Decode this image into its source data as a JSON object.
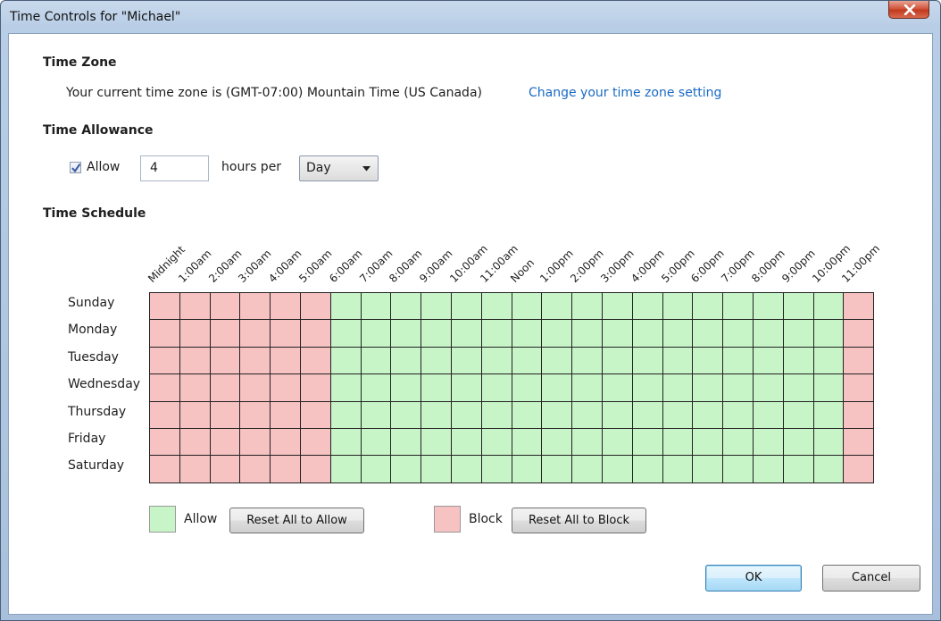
{
  "window": {
    "title": "Time Controls for \"Michael\""
  },
  "time_zone": {
    "heading": "Time Zone",
    "text": "Your current time zone is (GMT-07:00) Mountain Time (US  Canada)",
    "link": "Change your time zone setting"
  },
  "allowance": {
    "heading": "Time Allowance",
    "checkbox_label": "Allow",
    "checked": true,
    "hours_value": "4",
    "hours_label": "hours per",
    "period_value": "Day"
  },
  "schedule": {
    "heading": "Time Schedule",
    "hours": [
      "Midnight",
      "1:00am",
      "2:00am",
      "3:00am",
      "4:00am",
      "5:00am",
      "6:00am",
      "7:00am",
      "8:00am",
      "9:00am",
      "10:00am",
      "11:00am",
      "Noon",
      "1:00pm",
      "2:00pm",
      "3:00pm",
      "4:00pm",
      "5:00pm",
      "6:00pm",
      "7:00pm",
      "8:00pm",
      "9:00pm",
      "10:00pm",
      "11:00pm"
    ],
    "days": [
      "Sunday",
      "Monday",
      "Tuesday",
      "Wednesday",
      "Thursday",
      "Friday",
      "Saturday"
    ],
    "grid": [
      "BBBBBBAAAAAAAAAAAAAAAAAB",
      "BBBBBBAAAAAAAAAAAAAAAAAB",
      "BBBBBBAAAAAAAAAAAAAAAAAB",
      "BBBBBBAAAAAAAAAAAAAAAAAB",
      "BBBBBBAAAAAAAAAAAAAAAAAB",
      "BBBBBBAAAAAAAAAAAAAAAAAB",
      "BBBBBBAAAAAAAAAAAAAAAAAB"
    ],
    "colors": {
      "allow": "#c8f5c8",
      "block": "#f7c2c2"
    }
  },
  "legend": {
    "allow_label": "Allow",
    "reset_allow_button": "Reset All to Allow",
    "block_label": "Block",
    "reset_block_button": "Reset All to Block"
  },
  "buttons": {
    "ok": "OK",
    "cancel": "Cancel"
  }
}
